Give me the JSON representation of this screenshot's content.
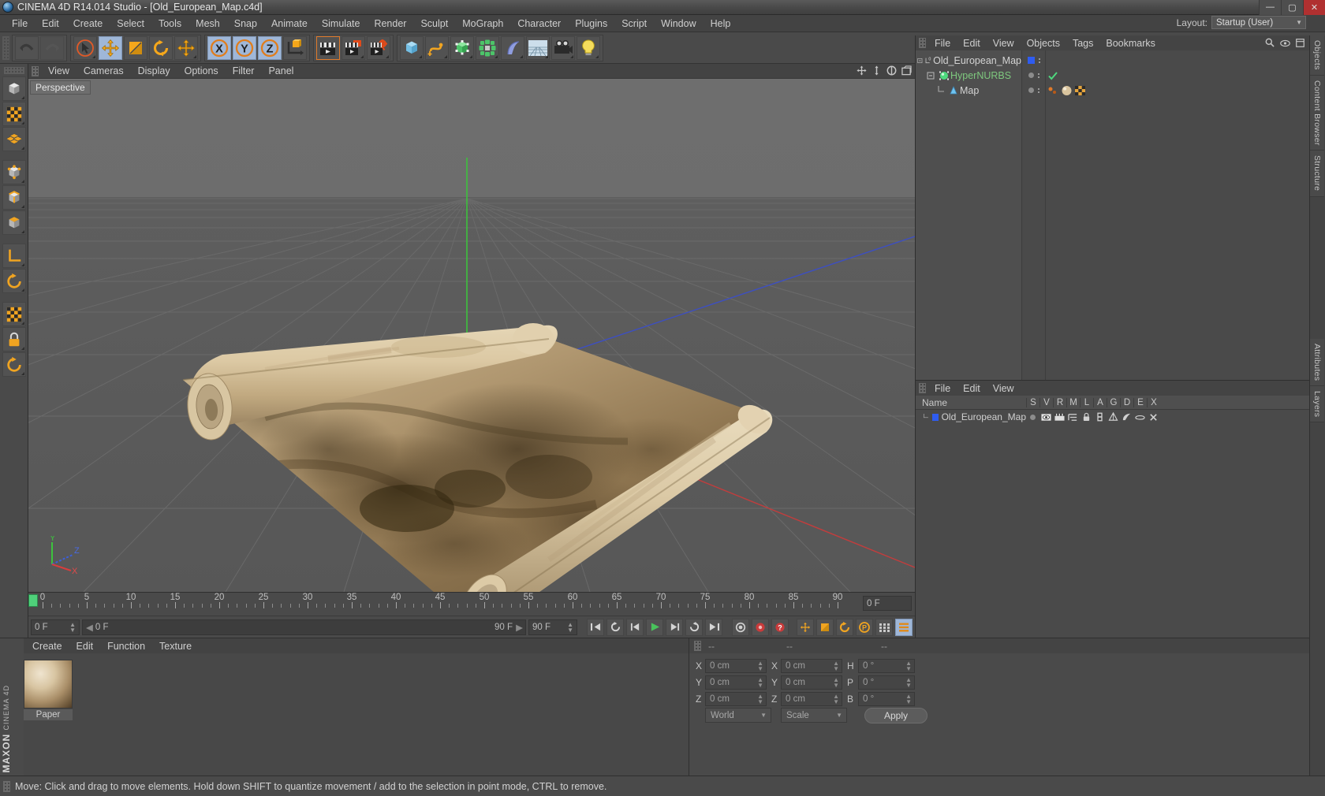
{
  "titlebar": {
    "title": "CINEMA 4D R14.014 Studio - [Old_European_Map.c4d]",
    "minimize": "—",
    "maximize": "▢",
    "close": "✕"
  },
  "menubar": {
    "items": [
      "File",
      "Edit",
      "Create",
      "Select",
      "Tools",
      "Mesh",
      "Snap",
      "Animate",
      "Simulate",
      "Render",
      "Sculpt",
      "MoGraph",
      "Character",
      "Plugins",
      "Script",
      "Window",
      "Help"
    ],
    "layout_label": "Layout:",
    "layout_value": "Startup (User)"
  },
  "toolbar": {
    "groups": [
      {
        "name": "undo-redo",
        "buttons": [
          {
            "name": "undo-button",
            "icon": "undo-icon",
            "state": "normal"
          },
          {
            "name": "redo-button",
            "icon": "redo-icon",
            "state": "disabled"
          }
        ]
      },
      {
        "name": "transform-tools",
        "buttons": [
          {
            "name": "live-selection-tool",
            "icon": "cursor-circle-icon",
            "state": "selected"
          },
          {
            "name": "move-tool",
            "icon": "move-arrows-icon",
            "state": "active"
          },
          {
            "name": "scale-tool",
            "icon": "scale-square-icon",
            "state": "normal"
          },
          {
            "name": "rotate-tool",
            "icon": "rotate-circle-icon",
            "state": "normal"
          },
          {
            "name": "move-alt-tool",
            "icon": "move-arrows-icon",
            "state": "normal"
          }
        ]
      },
      {
        "name": "axis-locks",
        "buttons": [
          {
            "name": "x-axis-lock",
            "icon": "x-axis-icon",
            "state": "active"
          },
          {
            "name": "y-axis-lock",
            "icon": "y-axis-icon",
            "state": "active"
          },
          {
            "name": "z-axis-lock",
            "icon": "z-axis-icon",
            "state": "active"
          },
          {
            "name": "world-object-coord",
            "icon": "world-axis-cube-icon",
            "state": "normal"
          }
        ]
      },
      {
        "name": "render-tools",
        "buttons": [
          {
            "name": "render-view-button",
            "icon": "clapper-icon",
            "state": "selected"
          },
          {
            "name": "render-region-button",
            "icon": "clapper-region-icon",
            "state": "normal"
          },
          {
            "name": "render-settings-button",
            "icon": "clapper-gear-icon",
            "state": "normal"
          }
        ]
      },
      {
        "name": "object-creation",
        "buttons": [
          {
            "name": "add-cube-button",
            "icon": "cube-icon",
            "state": "normal"
          },
          {
            "name": "add-spline-button",
            "icon": "spline-icon",
            "state": "normal"
          },
          {
            "name": "add-nurbs-button",
            "icon": "nurbs-icon",
            "state": "normal"
          },
          {
            "name": "add-array-button",
            "icon": "array-icon",
            "state": "normal"
          },
          {
            "name": "add-deformer-button",
            "icon": "bend-deformer-icon",
            "state": "normal"
          },
          {
            "name": "add-environment-button",
            "icon": "floor-environment-icon",
            "state": "normal"
          },
          {
            "name": "add-camera-button",
            "icon": "camera-icon",
            "state": "normal"
          },
          {
            "name": "add-light-button",
            "icon": "light-bulb-icon",
            "state": "normal"
          }
        ]
      }
    ]
  },
  "left_palette": {
    "buttons": [
      {
        "name": "model-mode-button",
        "icon": "model-cube-icon"
      },
      {
        "name": "texture-mode-button",
        "icon": "texture-checker-icon"
      },
      {
        "name": "polygon-mode-button",
        "icon": "polygon-mesh-icon"
      },
      {
        "name": "points-mode-button",
        "icon": "points-cube-icon"
      },
      {
        "name": "edges-mode-button",
        "icon": "edges-cube-icon"
      },
      {
        "name": "polygons-mode-button",
        "icon": "polygons-cube-icon"
      },
      {
        "name": "axis-modify-button",
        "icon": "axis-corner-icon"
      },
      {
        "name": "enable-axis-button",
        "icon": "axis-rotate-icon"
      },
      {
        "name": "viewport-solo-button",
        "icon": "checker-grid-icon"
      },
      {
        "name": "lock-axis-button",
        "icon": "padlock-icon"
      },
      {
        "name": "quantize-button",
        "icon": "quantize-circle-icon"
      }
    ]
  },
  "viewport": {
    "menu": [
      "View",
      "Cameras",
      "Display",
      "Options",
      "Filter",
      "Panel"
    ],
    "label": "Perspective",
    "nav_icons": [
      "pan-icon",
      "dolly-icon",
      "rotate-view-icon",
      "maximize-view-icon"
    ],
    "gizmo": {
      "y": "Y",
      "z": "Z",
      "x": "X"
    }
  },
  "timeline": {
    "ticks": [
      0,
      5,
      10,
      15,
      20,
      25,
      30,
      35,
      40,
      45,
      50,
      55,
      60,
      65,
      70,
      75,
      80,
      85,
      90
    ],
    "current_frame_field": "0 F",
    "start_field": "0 F",
    "preview_start": "0 F",
    "preview_end": "90 F",
    "end_field": "90 F"
  },
  "transport": {
    "buttons": [
      {
        "name": "go-to-start-button",
        "icon": "skip-start-icon",
        "state": "normal"
      },
      {
        "name": "play-back-loop-button",
        "icon": "loop-back-icon",
        "state": "normal"
      },
      {
        "name": "step-back-button",
        "icon": "step-back-icon",
        "state": "normal"
      },
      {
        "name": "play-button",
        "icon": "play-icon",
        "state": "green"
      },
      {
        "name": "step-forward-button",
        "icon": "step-forward-icon",
        "state": "normal"
      },
      {
        "name": "play-forward-loop-button",
        "icon": "loop-forward-icon",
        "state": "normal"
      },
      {
        "name": "go-to-end-button",
        "icon": "skip-end-icon",
        "state": "normal"
      },
      {
        "name": "record-active-objects-button",
        "icon": "record-keys-icon",
        "state": "normal"
      },
      {
        "name": "autokeying-button",
        "icon": "record-dot-icon",
        "state": "normal"
      },
      {
        "name": "keyframe-selection-button",
        "icon": "question-keyframe-icon",
        "state": "normal"
      },
      {
        "name": "position-key-button",
        "icon": "position-key-icon",
        "state": "normal"
      },
      {
        "name": "scale-key-button",
        "icon": "scale-key-icon",
        "state": "normal"
      },
      {
        "name": "rotation-key-button",
        "icon": "rotation-key-icon",
        "state": "normal"
      },
      {
        "name": "param-key-button",
        "icon": "param-p-key-icon",
        "state": "normal"
      },
      {
        "name": "pla-key-button",
        "icon": "pla-key-icon",
        "state": "normal"
      },
      {
        "name": "timeline-toggle-button",
        "icon": "timeline-bars-icon",
        "state": "active"
      }
    ]
  },
  "material_manager": {
    "menu": [
      "Create",
      "Edit",
      "Function",
      "Texture"
    ],
    "materials": [
      {
        "name": "Paper",
        "preview": "sphere-paper"
      }
    ],
    "brand": "MAXON",
    "brand_sub": "CINEMA 4D"
  },
  "coordinate_manager": {
    "headers": [
      "--",
      "--",
      "--"
    ],
    "rows": [
      {
        "axis": "X",
        "position": "0 cm",
        "axis2": "X",
        "size": "0 cm",
        "rot_label": "H",
        "rotation": "0 °"
      },
      {
        "axis": "Y",
        "position": "0 cm",
        "axis2": "Y",
        "size": "0 cm",
        "rot_label": "P",
        "rotation": "0 °"
      },
      {
        "axis": "Z",
        "position": "0 cm",
        "axis2": "Z",
        "size": "0 cm",
        "rot_label": "B",
        "rotation": "0 °"
      }
    ],
    "coord_system": "World",
    "size_mode": "Scale",
    "apply_label": "Apply"
  },
  "object_manager": {
    "menu": [
      "File",
      "Edit",
      "View",
      "Objects",
      "Tags",
      "Bookmarks"
    ],
    "search_icons": [
      "search-icon",
      "eye-icon",
      "window-icon"
    ],
    "items": [
      {
        "name": "Old_European_Map",
        "icon": "null-object-icon",
        "depth": 0,
        "color": "#2f5cf0",
        "green": false,
        "tags": []
      },
      {
        "name": "HyperNURBS",
        "icon": "hypernurbs-icon",
        "depth": 1,
        "green": true,
        "check": true,
        "tags": []
      },
      {
        "name": "Map",
        "icon": "polygon-object-icon",
        "depth": 2,
        "green": false,
        "tags": [
          "texture-tag",
          "material-tag",
          "uvw-tag"
        ]
      }
    ]
  },
  "layer_manager": {
    "menu": [
      "File",
      "Edit",
      "View"
    ],
    "columns": [
      "Name",
      "S",
      "V",
      "R",
      "M",
      "L",
      "A",
      "G",
      "D",
      "E",
      "X"
    ],
    "rows": [
      {
        "name": "Old_European_Map",
        "color": "#2f5cf0"
      }
    ]
  },
  "edge_tabs": [
    "Objects",
    "Content Browser",
    "Structure",
    "Attributes",
    "Layers"
  ],
  "statusbar": {
    "message": "Move: Click and drag to move elements. Hold down SHIFT to quantize movement / add to the selection in point mode, CTRL to remove."
  },
  "colors": {
    "accent_orange": "#f0a020",
    "active_blue": "#9fb7d8",
    "panel_bg": "#4a4a4a",
    "viewport_bg": "#5a5a5a",
    "green_axis": "#40c040",
    "red_axis": "#c04040",
    "blue_axis": "#4040c0"
  }
}
